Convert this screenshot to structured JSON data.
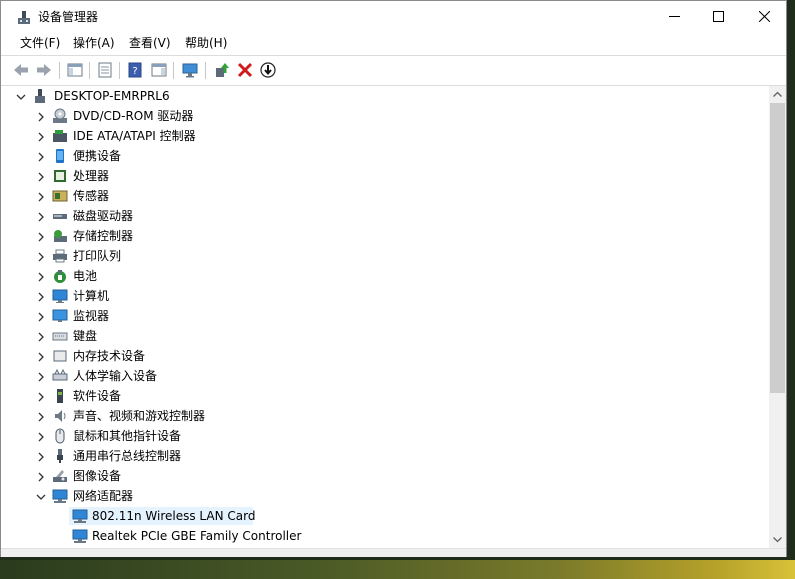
{
  "window": {
    "title": "设备管理器",
    "controls": {
      "minimize": "minimize-icon",
      "maximize": "maximize-icon",
      "close": "close-icon"
    }
  },
  "menu": [
    {
      "label": "文件(F)"
    },
    {
      "label": "操作(A)"
    },
    {
      "label": "查看(V)"
    },
    {
      "label": "帮助(H)"
    }
  ],
  "toolbar": {
    "buttons": [
      "back-icon",
      "forward-icon",
      "show-hide-console-tree-icon",
      "properties-icon",
      "help-icon",
      "show-action-pane-icon",
      "scan-hardware-icon",
      "update-driver-icon",
      "uninstall-device-icon",
      "disable-device-icon"
    ]
  },
  "tree": {
    "root": "DESKTOP-EMRPRL6",
    "categories": [
      {
        "label": "DVD/CD-ROM 驱动器",
        "icon": "dvd-drive-icon"
      },
      {
        "label": "IDE ATA/ATAPI 控制器",
        "icon": "ide-controller-icon"
      },
      {
        "label": "便携设备",
        "icon": "portable-device-icon"
      },
      {
        "label": "处理器",
        "icon": "processor-icon"
      },
      {
        "label": "传感器",
        "icon": "sensor-icon"
      },
      {
        "label": "磁盘驱动器",
        "icon": "disk-drive-icon"
      },
      {
        "label": "存储控制器",
        "icon": "storage-controller-icon"
      },
      {
        "label": "打印队列",
        "icon": "print-queue-icon"
      },
      {
        "label": "电池",
        "icon": "battery-icon"
      },
      {
        "label": "计算机",
        "icon": "computer-icon"
      },
      {
        "label": "监视器",
        "icon": "monitor-icon"
      },
      {
        "label": "键盘",
        "icon": "keyboard-icon"
      },
      {
        "label": "内存技术设备",
        "icon": "memory-device-icon"
      },
      {
        "label": "人体学输入设备",
        "icon": "hid-icon"
      },
      {
        "label": "软件设备",
        "icon": "software-device-icon"
      },
      {
        "label": "声音、视频和游戏控制器",
        "icon": "sound-icon"
      },
      {
        "label": "鼠标和其他指针设备",
        "icon": "mouse-icon"
      },
      {
        "label": "通用串行总线控制器",
        "icon": "usb-icon"
      },
      {
        "label": "图像设备",
        "icon": "camera-icon"
      },
      {
        "label": "网络适配器",
        "icon": "network-adapter-icon",
        "expanded": true
      }
    ],
    "network_children": [
      {
        "label": "802.11n Wireless LAN Card",
        "selected": true
      },
      {
        "label": "Realtek PCIe GBE Family Controller",
        "selected": false
      }
    ]
  }
}
